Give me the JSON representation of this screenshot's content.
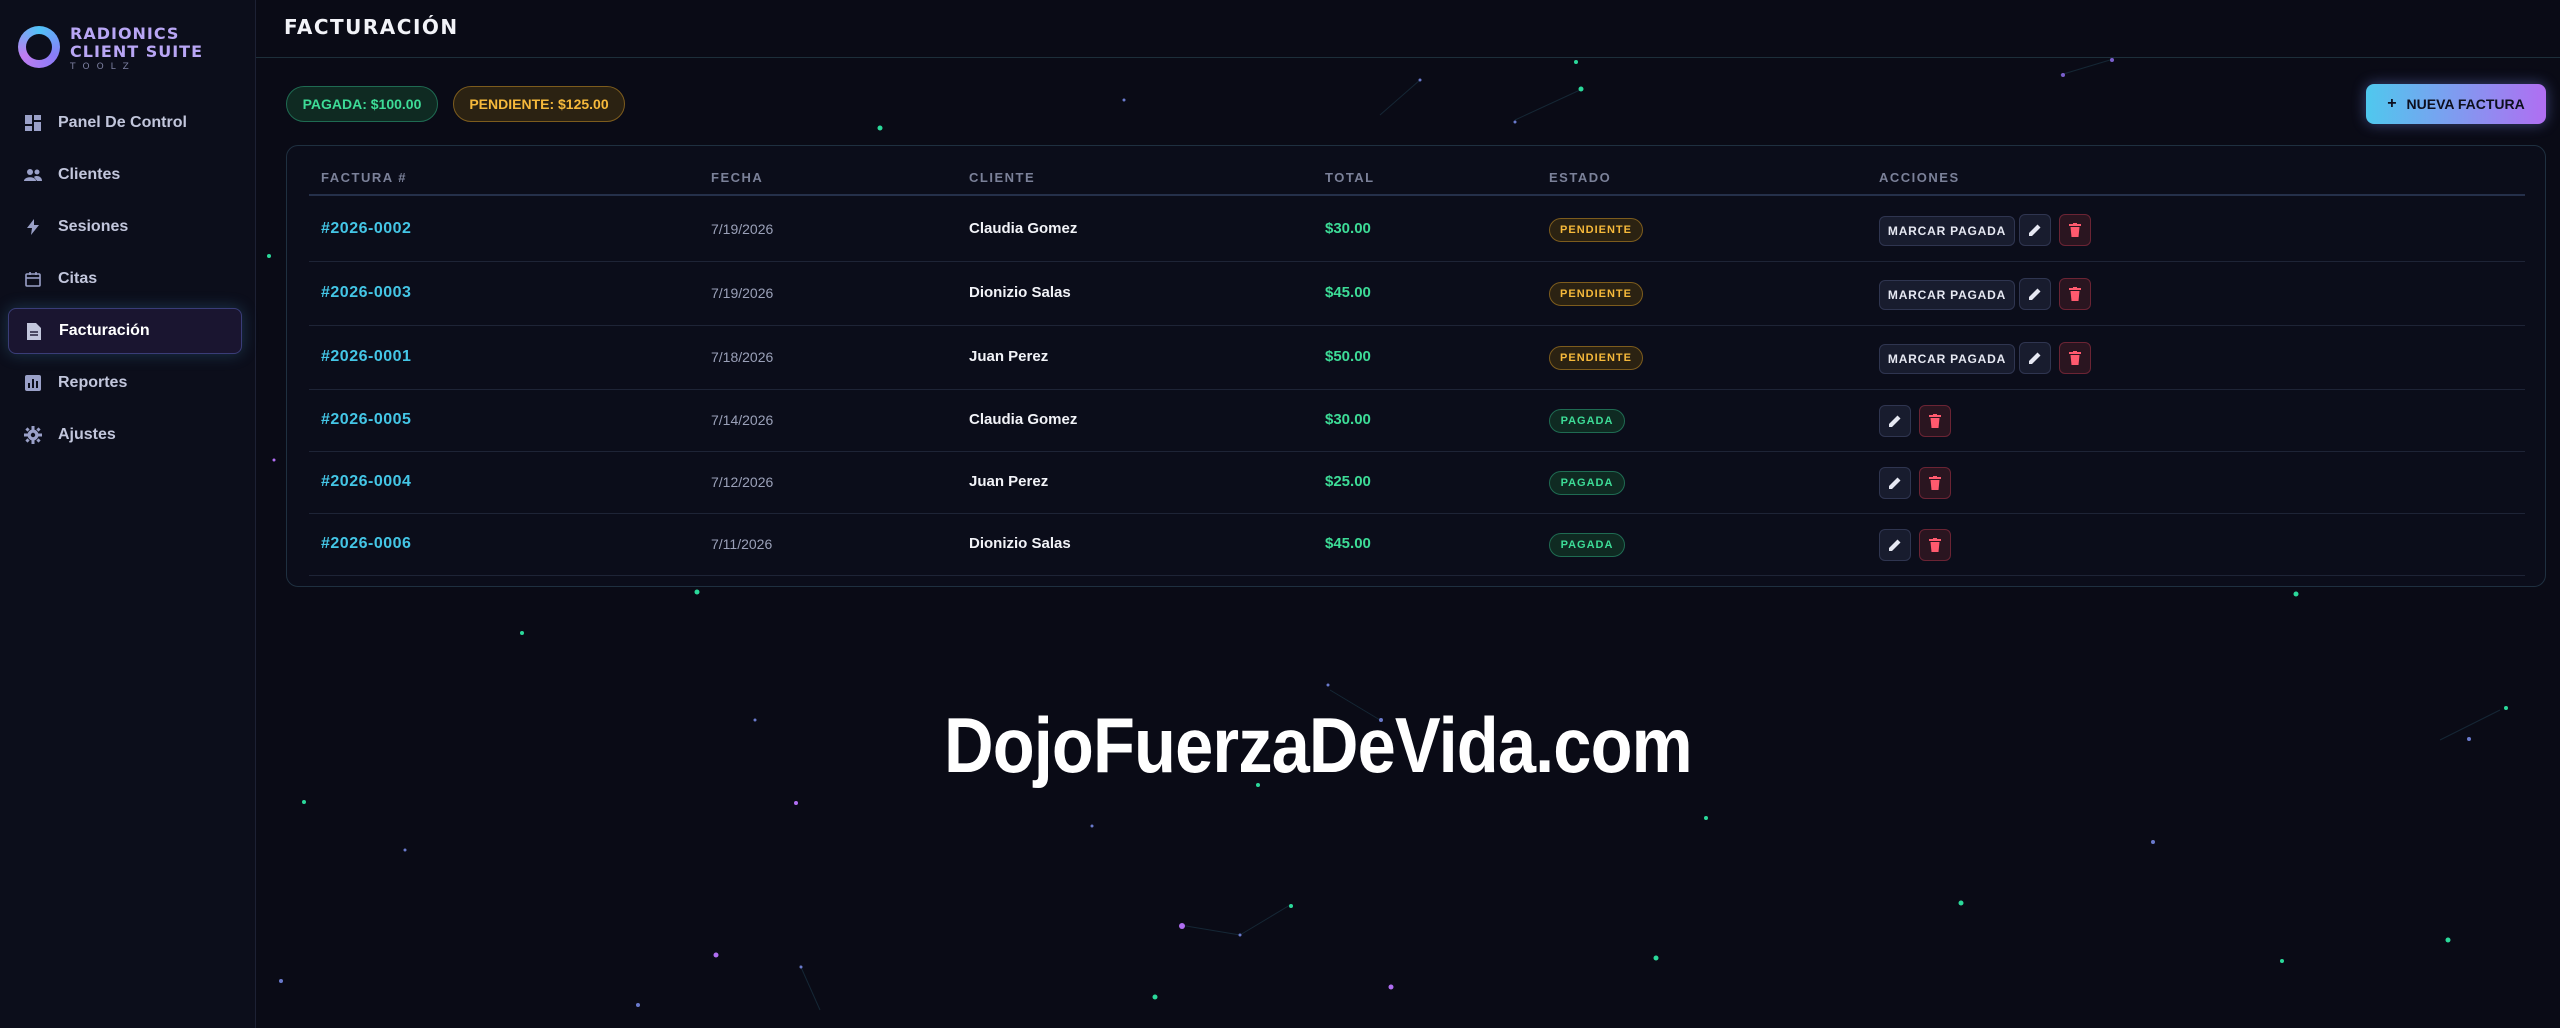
{
  "brand": {
    "line1": "RADIONICS",
    "line2": "CLIENT SUITE",
    "line3": "TOOLZ"
  },
  "sidebar": {
    "items": [
      {
        "label": "Panel De Control",
        "icon": "dashboard-icon"
      },
      {
        "label": "Clientes",
        "icon": "people-icon"
      },
      {
        "label": "Sesiones",
        "icon": "lightning-icon"
      },
      {
        "label": "Citas",
        "icon": "calendar-icon"
      },
      {
        "label": "Facturación",
        "icon": "document-icon",
        "active": true
      },
      {
        "label": "Reportes",
        "icon": "bar-chart-icon"
      },
      {
        "label": "Ajustes",
        "icon": "gear-icon"
      }
    ]
  },
  "header": {
    "title": "FACTURACIÓN"
  },
  "summary": {
    "paid": "PAGADA: $100.00",
    "pending": "PENDIENTE: $125.00"
  },
  "actions": {
    "new_invoice": "NUEVA FACTURA"
  },
  "table": {
    "columns": [
      "FACTURA #",
      "FECHA",
      "CLIENTE",
      "TOTAL",
      "ESTADO",
      "ACCIONES"
    ],
    "mark_paid_label": "MARCAR PAGADA",
    "rows": [
      {
        "invoice": "#2026-0002",
        "date": "7/19/2026",
        "client": "Claudia Gomez",
        "total": "$30.00",
        "status": "PENDIENTE"
      },
      {
        "invoice": "#2026-0003",
        "date": "7/19/2026",
        "client": "Dionizio Salas",
        "total": "$45.00",
        "status": "PENDIENTE"
      },
      {
        "invoice": "#2026-0001",
        "date": "7/18/2026",
        "client": "Juan Perez",
        "total": "$50.00",
        "status": "PENDIENTE"
      },
      {
        "invoice": "#2026-0005",
        "date": "7/14/2026",
        "client": "Claudia Gomez",
        "total": "$30.00",
        "status": "PAGADA"
      },
      {
        "invoice": "#2026-0004",
        "date": "7/12/2026",
        "client": "Juan Perez",
        "total": "$25.00",
        "status": "PAGADA"
      },
      {
        "invoice": "#2026-0006",
        "date": "7/11/2026",
        "client": "Dionizio Salas",
        "total": "$45.00",
        "status": "PAGADA"
      }
    ]
  },
  "watermark": "DojoFuerzaDeVida.com",
  "colors": {
    "background": "#0a0b16",
    "accent_cyan": "#44c6e6",
    "paid_green": "#3ddc97",
    "pending_amber": "#f6b93b",
    "delete_red": "#ff5a6e"
  }
}
